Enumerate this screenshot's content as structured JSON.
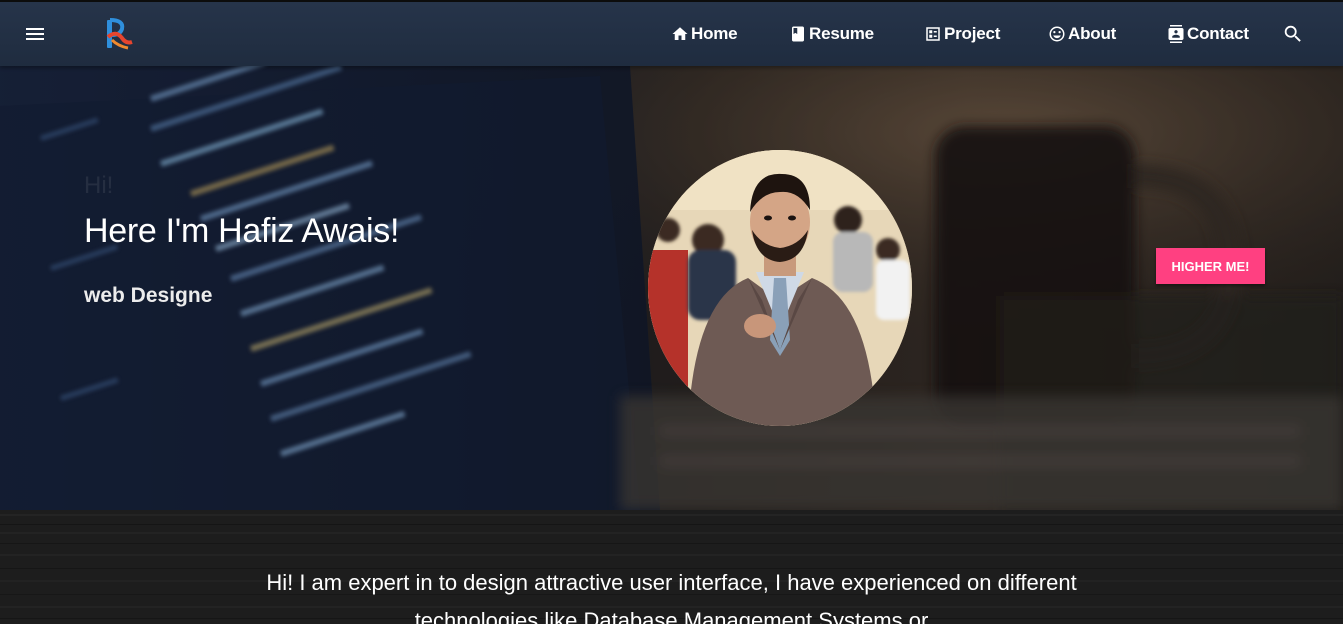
{
  "nav": {
    "links": [
      {
        "label": "Home",
        "icon": "home-icon"
      },
      {
        "label": "Resume",
        "icon": "book-icon"
      },
      {
        "label": "Project",
        "icon": "dashboard-icon"
      },
      {
        "label": "About",
        "icon": "smiley-icon"
      },
      {
        "label": "Contact",
        "icon": "contact-card-icon"
      }
    ],
    "menu_icon": "menu-icon",
    "search_icon": "search-icon"
  },
  "hero": {
    "greeting": "Hi!",
    "headline": "Here I'm Hafiz Awais!",
    "subtitle": "web Designe",
    "cta_label": "HIGHER ME!"
  },
  "intro": {
    "text": "Hi! I am expert in to design attractive user interface, I have experienced on different technologies like Database Management Systems or"
  },
  "colors": {
    "navbar": "#1f2c3f",
    "cta": "#ff4081",
    "text": "#ffffff"
  }
}
